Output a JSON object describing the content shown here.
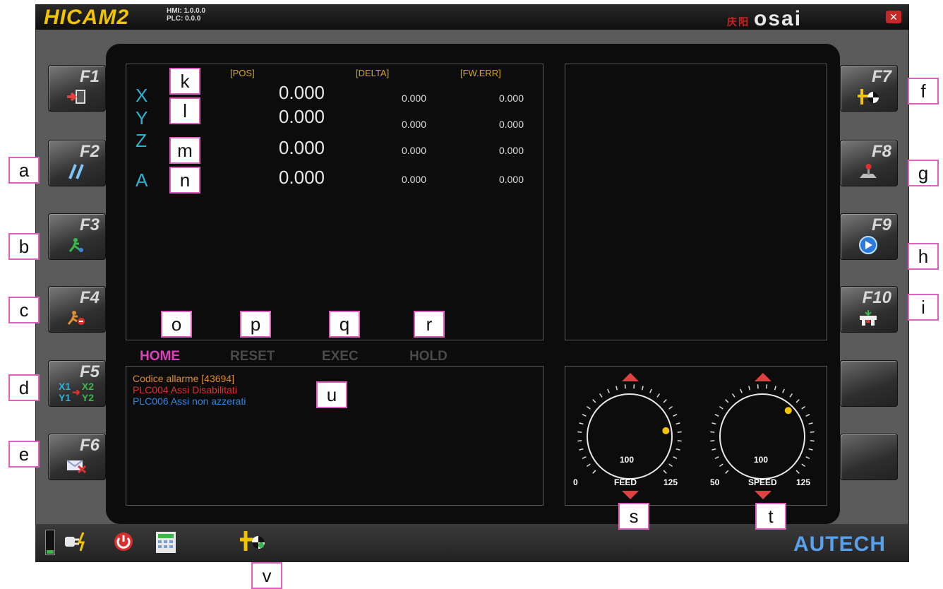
{
  "titlebar": {
    "brand": "HICAM2",
    "hmi_version": "HMI: 1.0.0.0",
    "plc_version": "PLC: 0.0.0",
    "vendor_logo": "osai",
    "vendor_small": "庆阳"
  },
  "function_keys": [
    {
      "label": "F1",
      "icon": "exit-door-icon"
    },
    {
      "label": "F2",
      "icon": "parallel-lines-icon"
    },
    {
      "label": "F3",
      "icon": "running-man-icon"
    },
    {
      "label": "F4",
      "icon": "running-man-stop-icon"
    },
    {
      "label": "F5",
      "icon": "axis-swap-icon"
    },
    {
      "label": "F6",
      "icon": "mail-cancel-icon"
    },
    {
      "label": "F7",
      "icon": "crosshair-target-icon"
    },
    {
      "label": "F8",
      "icon": "joystick-icon"
    },
    {
      "label": "F9",
      "icon": "play-icon"
    },
    {
      "label": "F10",
      "icon": "machine-icon"
    }
  ],
  "axes_table": {
    "columns": [
      "[POS]",
      "[DELTA]",
      "[FW.ERR]"
    ],
    "rows": [
      {
        "axis": "X",
        "pos": "0.000",
        "delta": "0.000",
        "fwerr": "0.000"
      },
      {
        "axis": "Y",
        "pos": "0.000",
        "delta": "0.000",
        "fwerr": "0.000"
      },
      {
        "axis": "Z",
        "pos": "0.000",
        "delta": "0.000",
        "fwerr": "0.000"
      },
      {
        "axis": "A",
        "pos": "0.000",
        "delta": "0.000",
        "fwerr": "0.000"
      }
    ]
  },
  "status_buttons": [
    "HOME",
    "RESET",
    "EXEC",
    "HOLD"
  ],
  "alarms": [
    {
      "text": "Codice allarme [43694]",
      "color": "#e08a2a"
    },
    {
      "text": "PLC004  Assi Disabilitati",
      "color": "#e03030"
    },
    {
      "text": "PLC006  Assi non azzerati",
      "color": "#2a86e0"
    }
  ],
  "gauges": {
    "feed": {
      "label": "FEED",
      "min": "0",
      "max": "125",
      "value": "100",
      "level": 100
    },
    "speed": {
      "label": "SPEED",
      "min": "50",
      "max": "125",
      "value": "100",
      "level": 100
    }
  },
  "bottom_bar": {
    "icons": [
      "battery-icon",
      "power-plug-icon",
      "power-button-icon",
      "calculator-icon",
      "tool-target-icon"
    ],
    "footer_logo": "AUTECH"
  },
  "callouts": {
    "left": [
      "a",
      "b",
      "c",
      "d",
      "e"
    ],
    "right": [
      "f",
      "g",
      "h",
      "i"
    ],
    "axes": [
      "k",
      "l",
      "m",
      "n"
    ],
    "status": [
      "o",
      "p",
      "q",
      "r"
    ],
    "gauges": [
      "s",
      "t"
    ],
    "alarm": "u",
    "bottom": "v"
  },
  "colors": {
    "accent_yellow": "#f2c400",
    "axis_cyan": "#2ab3d8",
    "home_magenta": "#e040c0",
    "callout_border": "#e060c0"
  }
}
